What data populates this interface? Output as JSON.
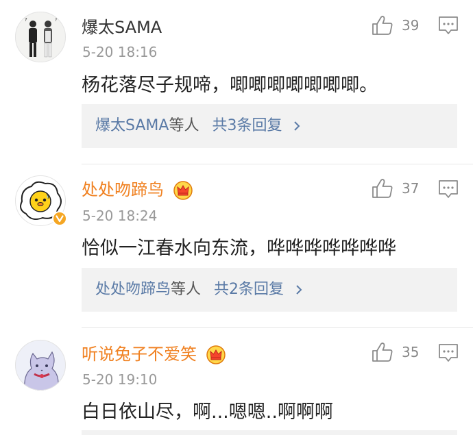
{
  "comments": [
    {
      "username": "爆太SAMA",
      "time": "5-20 18:16",
      "text": "杨花落尽子规啼，唧唧唧唧唧唧唧。",
      "likes": "39",
      "vip": false,
      "avatar": "two-men-photo-avatar",
      "reply_summary": {
        "names": "爆太SAMA",
        "suffix": "等人",
        "count_text": "共3条回复"
      }
    },
    {
      "username": "处处吻蹄鸟",
      "time": "5-20 18:24",
      "text": "恰似一江春水向东流，哗哗哗哗哗哗哗",
      "likes": "37",
      "vip": true,
      "avatar": "cartoon-chick-avatar",
      "reply_summary": {
        "names": "处处吻蹄鸟",
        "suffix": "等人",
        "count_text": "共2条回复"
      }
    },
    {
      "username": "听说兔子不爱笑",
      "time": "5-20 19:10",
      "text": "白日依山尽，啊...嗯嗯..啊啊啊",
      "likes": "35",
      "vip": true,
      "avatar": "anime-cat-avatar"
    }
  ],
  "icons": {
    "like": "thumbs-up-icon",
    "reply": "comment-bubble-icon",
    "vip": "crown-badge-icon",
    "verified": "verified-v-icon",
    "more": "chevron-right-icon"
  },
  "colors": {
    "vip_name": "#f08121",
    "reply_link": "#5a7aa6",
    "reply_bg": "#f2f2f2",
    "meta": "#999999"
  }
}
